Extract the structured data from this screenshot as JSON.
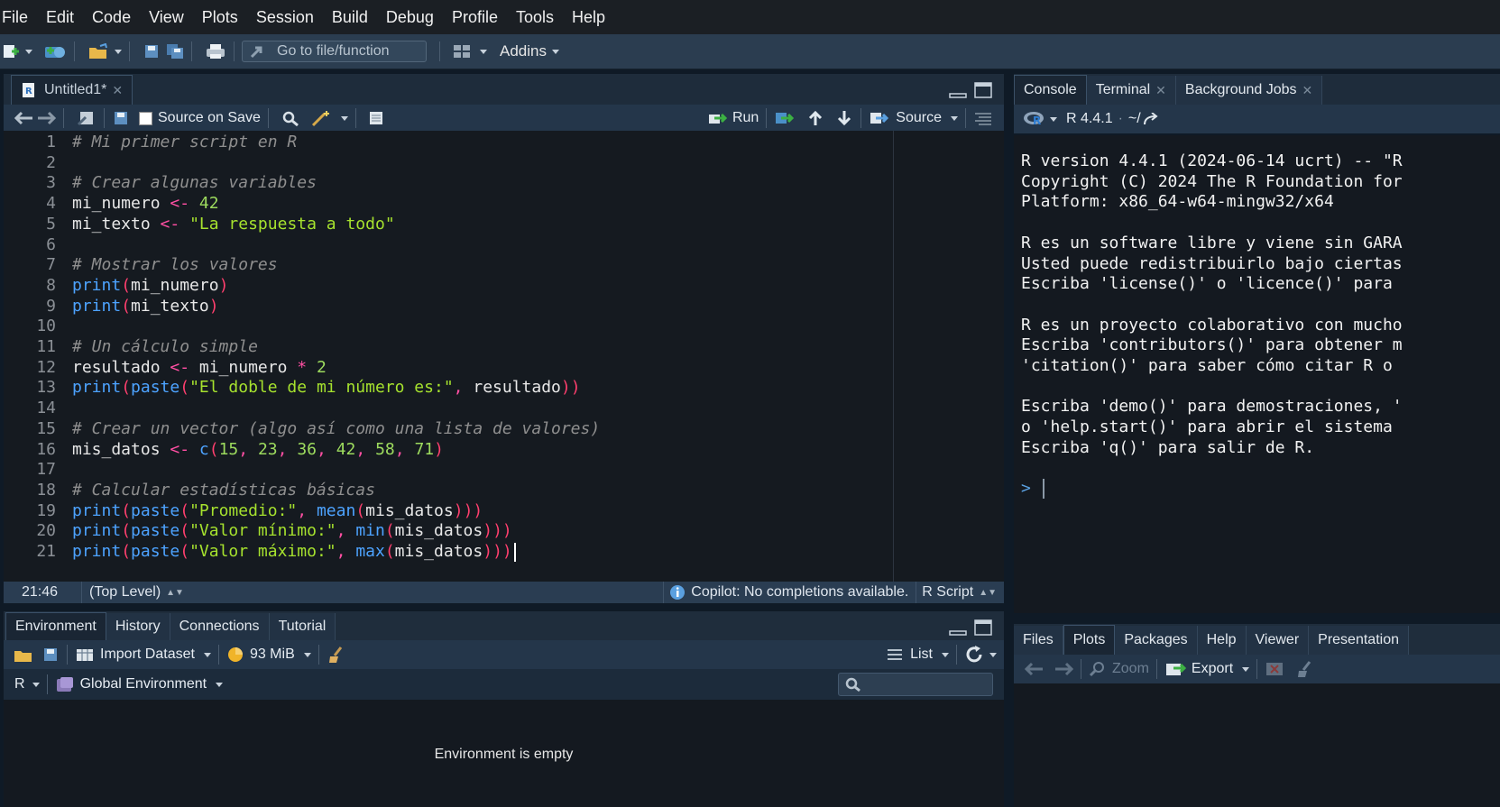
{
  "menubar": [
    "File",
    "Edit",
    "Code",
    "View",
    "Plots",
    "Session",
    "Build",
    "Debug",
    "Profile",
    "Tools",
    "Help"
  ],
  "toolbar": {
    "goto_placeholder": "Go to file/function",
    "addins": "Addins"
  },
  "editor": {
    "tab": "Untitled1*",
    "source_on_save": "Source on Save",
    "run": "Run",
    "source": "Source",
    "lines": [
      "# Mi primer script en R",
      "",
      "# Crear algunas variables",
      "mi_numero <- 42",
      "mi_texto <- \"La respuesta a todo\"",
      "",
      "# Mostrar los valores",
      "print(mi_numero)",
      "print(mi_texto)",
      "",
      "# Un cálculo simple",
      "resultado <- mi_numero * 2",
      "print(paste(\"El doble de mi número es:\", resultado))",
      "",
      "# Crear un vector (algo así como una lista de valores)",
      "mis_datos <- c(15, 23, 36, 42, 58, 71)",
      "",
      "# Calcular estadísticas básicas",
      "print(paste(\"Promedio:\", mean(mis_datos)))",
      "print(paste(\"Valor mínimo:\", min(mis_datos)))",
      "print(paste(\"Valor máximo:\", max(mis_datos)))"
    ],
    "status": {
      "position": "21:46",
      "scope": "(Top Level)",
      "copilot": "Copilot: No completions available.",
      "filetype": "R Script"
    }
  },
  "console_pane": {
    "tabs": [
      "Console",
      "Terminal",
      "Background Jobs"
    ],
    "r_version": "R 4.4.1",
    "path": "~/",
    "lines": [
      "R version 4.4.1 (2024-06-14 ucrt) -- \"R",
      "Copyright (C) 2024 The R Foundation for",
      "Platform: x86_64-w64-mingw32/x64",
      "",
      "R es un software libre y viene sin GARA",
      "Usted puede redistribuirlo bajo ciertas",
      "Escriba 'license()' o 'licence()' para",
      "",
      "R es un proyecto colaborativo con mucho",
      "Escriba 'contributors()' para obtener m",
      "'citation()' para saber cómo citar R o",
      "",
      "Escriba 'demo()' para demostraciones, '",
      "o 'help.start()' para abrir el sistema",
      "Escriba 'q()' para salir de R."
    ],
    "prompt": ">"
  },
  "env_pane": {
    "tabs": [
      "Environment",
      "History",
      "Connections",
      "Tutorial"
    ],
    "import_dataset": "Import Dataset",
    "memory": "93 MiB",
    "list": "List",
    "lang": "R",
    "global_env": "Global Environment",
    "empty_msg": "Environment is empty"
  },
  "files_pane": {
    "tabs": [
      "Files",
      "Plots",
      "Packages",
      "Help",
      "Viewer",
      "Presentation"
    ],
    "zoom": "Zoom",
    "export": "Export"
  }
}
